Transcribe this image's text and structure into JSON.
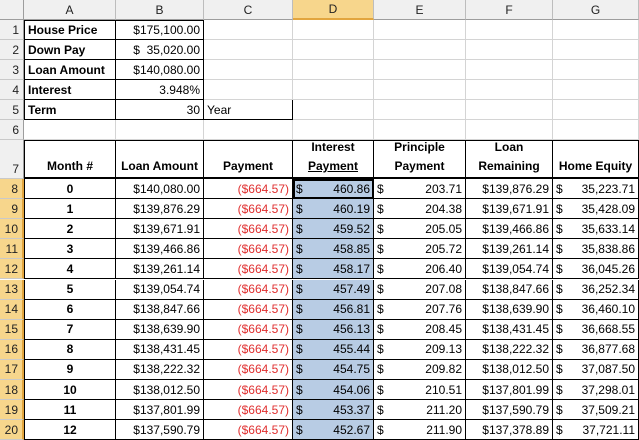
{
  "columns": [
    "A",
    "B",
    "C",
    "D",
    "E",
    "F",
    "G"
  ],
  "selected_column": "D",
  "top_block": {
    "house_price_label": "House Price",
    "house_price_value": "$175,100.00",
    "down_pay_label": "Down Pay",
    "down_pay_value": "$  35,020.00",
    "loan_amount_label": "Loan Amount",
    "loan_amount_value": "$140,080.00",
    "interest_label": "Interest",
    "interest_value": "3.948%",
    "term_label": "Term",
    "term_value": "30",
    "term_unit": "Year"
  },
  "headers": {
    "month": "Month #",
    "loan_amount": "Loan Amount",
    "payment": "Payment",
    "interest_line1": "Interest",
    "interest_line2": "Payment",
    "principle_line1": "Principle",
    "principle_line2": "Payment",
    "remaining_line1": "Loan",
    "remaining_line2": "Remaining",
    "equity": "Home Equity"
  },
  "rows": [
    {
      "row": "8",
      "month": "0",
      "loan": "$140,080.00",
      "payment": "($664.57)",
      "interest": "460.86",
      "principle": "203.71",
      "remaining": "$139,876.29",
      "equity": "35,223.71"
    },
    {
      "row": "9",
      "month": "1",
      "loan": "$139,876.29",
      "payment": "($664.57)",
      "interest": "460.19",
      "principle": "204.38",
      "remaining": "$139,671.91",
      "equity": "35,428.09"
    },
    {
      "row": "10",
      "month": "2",
      "loan": "$139,671.91",
      "payment": "($664.57)",
      "interest": "459.52",
      "principle": "205.05",
      "remaining": "$139,466.86",
      "equity": "35,633.14"
    },
    {
      "row": "11",
      "month": "3",
      "loan": "$139,466.86",
      "payment": "($664.57)",
      "interest": "458.85",
      "principle": "205.72",
      "remaining": "$139,261.14",
      "equity": "35,838.86"
    },
    {
      "row": "12",
      "month": "4",
      "loan": "$139,261.14",
      "payment": "($664.57)",
      "interest": "458.17",
      "principle": "206.40",
      "remaining": "$139,054.74",
      "equity": "36,045.26"
    },
    {
      "row": "13",
      "month": "5",
      "loan": "$139,054.74",
      "payment": "($664.57)",
      "interest": "457.49",
      "principle": "207.08",
      "remaining": "$138,847.66",
      "equity": "36,252.34"
    },
    {
      "row": "14",
      "month": "6",
      "loan": "$138,847.66",
      "payment": "($664.57)",
      "interest": "456.81",
      "principle": "207.76",
      "remaining": "$138,639.90",
      "equity": "36,460.10"
    },
    {
      "row": "15",
      "month": "7",
      "loan": "$138,639.90",
      "payment": "($664.57)",
      "interest": "456.13",
      "principle": "208.45",
      "remaining": "$138,431.45",
      "equity": "36,668.55"
    },
    {
      "row": "16",
      "month": "8",
      "loan": "$138,431.45",
      "payment": "($664.57)",
      "interest": "455.44",
      "principle": "209.13",
      "remaining": "$138,222.32",
      "equity": "36,877.68"
    },
    {
      "row": "17",
      "month": "9",
      "loan": "$138,222.32",
      "payment": "($664.57)",
      "interest": "454.75",
      "principle": "209.82",
      "remaining": "$138,012.50",
      "equity": "37,087.50"
    },
    {
      "row": "18",
      "month": "10",
      "loan": "$138,012.50",
      "payment": "($664.57)",
      "interest": "454.06",
      "principle": "210.51",
      "remaining": "$137,801.99",
      "equity": "37,298.01"
    },
    {
      "row": "19",
      "month": "11",
      "loan": "$137,801.99",
      "payment": "($664.57)",
      "interest": "453.37",
      "principle": "211.20",
      "remaining": "$137,590.79",
      "equity": "37,509.21"
    },
    {
      "row": "20",
      "month": "12",
      "loan": "$137,590.79",
      "payment": "($664.57)",
      "interest": "452.67",
      "principle": "211.90",
      "remaining": "$137,378.89",
      "equity": "37,721.11"
    }
  ],
  "currency_symbol": "$",
  "colors": {
    "selection_fill": "#b8cce4",
    "negative_text": "#e03030",
    "header_highlight": "#f7d68c"
  }
}
